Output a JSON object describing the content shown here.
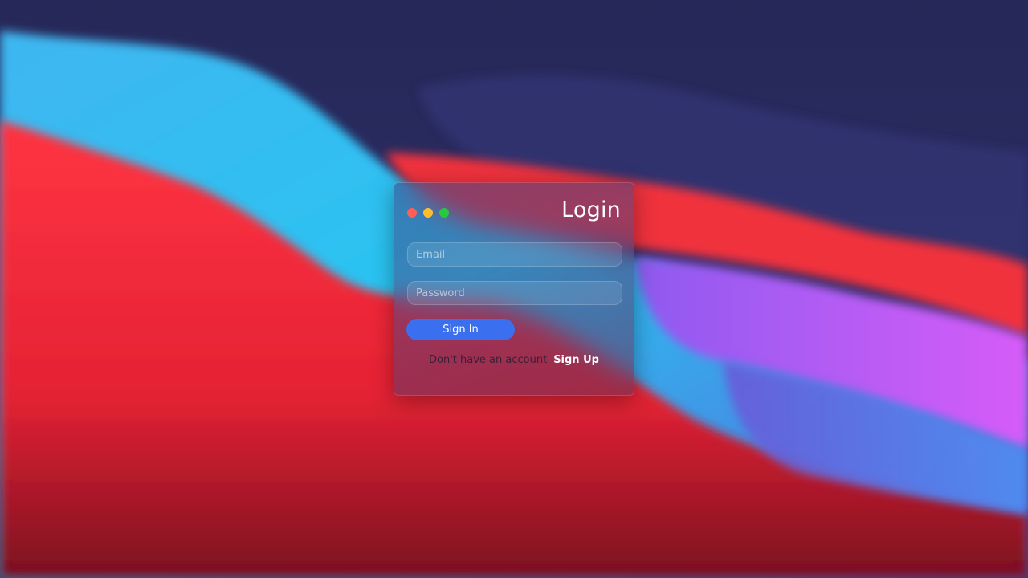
{
  "login": {
    "title": "Login",
    "email_placeholder": "Email",
    "password_placeholder": "Password",
    "signin_label": "Sign In",
    "signup_prompt": "Don't have an account",
    "signup_label": "Sign Up"
  },
  "window_controls": [
    "close",
    "minimize",
    "zoom"
  ],
  "colors": {
    "accent": "#3a6ff0",
    "close": "#ff5f57",
    "minimize": "#febc2e",
    "zoom": "#28c840"
  }
}
